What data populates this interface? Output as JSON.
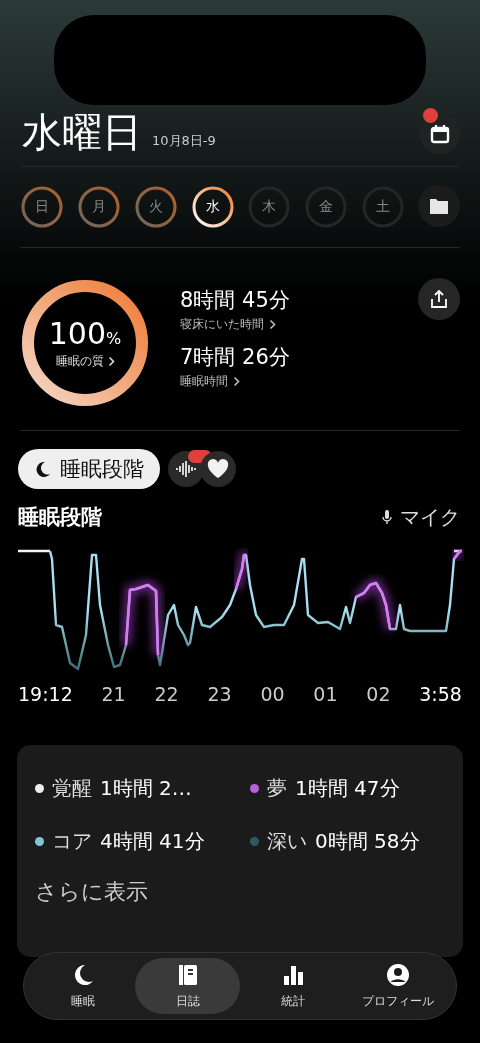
{
  "header": {
    "title": "水曜日",
    "date": "10月8日-9",
    "calendar_badge": true
  },
  "days": [
    {
      "label": "日",
      "recorded": true,
      "selected": false
    },
    {
      "label": "月",
      "recorded": true,
      "selected": false
    },
    {
      "label": "火",
      "recorded": true,
      "selected": false
    },
    {
      "label": "水",
      "recorded": true,
      "selected": true
    },
    {
      "label": "木",
      "recorded": false,
      "selected": false
    },
    {
      "label": "金",
      "recorded": false,
      "selected": false
    },
    {
      "label": "土",
      "recorded": false,
      "selected": false
    }
  ],
  "summary": {
    "quality": {
      "value": "100",
      "unit": "%",
      "label": "睡眠の質"
    },
    "stats": [
      {
        "value": "8時間 45分",
        "label": "寝床にいた時間"
      },
      {
        "value": "7時間 26分",
        "label": "睡眠時間"
      }
    ]
  },
  "view_tabs": [
    {
      "kind": "stages",
      "label": "睡眠段階",
      "selected": true
    },
    {
      "kind": "sound",
      "selected": false,
      "badge": true
    },
    {
      "kind": "heart",
      "selected": false
    }
  ],
  "stages": {
    "title": "睡眠段階",
    "source": "マイク",
    "time_labels": [
      "19:12",
      "21",
      "22",
      "23",
      "00",
      "01",
      "02",
      "3:58"
    ]
  },
  "legend": [
    {
      "name": "覚醒",
      "value": "1時間 2…",
      "color": "#eeeeee"
    },
    {
      "name": "夢",
      "value": "1時間 47分",
      "color": "#b85ee0"
    },
    {
      "name": "コア",
      "value": "4時間 41分",
      "color": "#7fc6d6"
    },
    {
      "name": "深い",
      "value": "0時間 58分",
      "color": "#2d5963"
    }
  ],
  "more": "さらに表示",
  "nav": [
    {
      "kind": "sleep",
      "label": "睡眠",
      "selected": false
    },
    {
      "kind": "journal",
      "label": "日誌",
      "selected": true
    },
    {
      "kind": "stats",
      "label": "統計",
      "selected": false
    },
    {
      "kind": "profile",
      "label": "プロフィール",
      "selected": false
    }
  ]
}
